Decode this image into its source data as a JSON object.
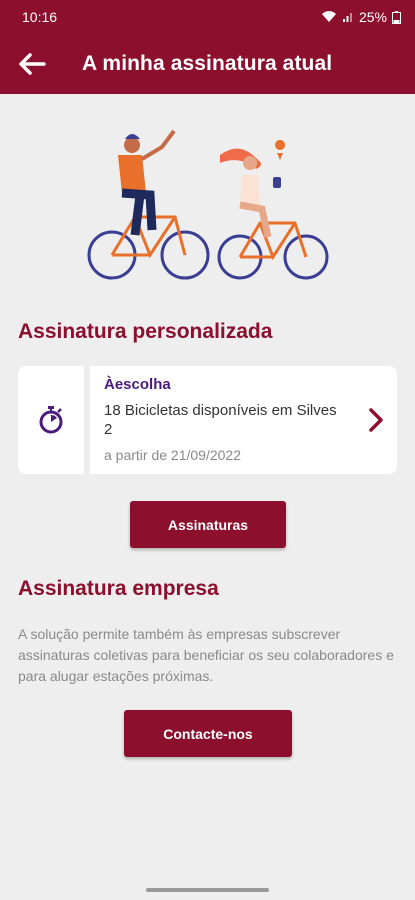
{
  "status_bar": {
    "time": "10:16",
    "battery": "25%"
  },
  "app_bar": {
    "title": "A minha assinatura atual"
  },
  "sections": {
    "personal_title": "Assinatura personalizada",
    "business_title": "Assinatura empresa"
  },
  "subscription_card": {
    "name": "Àescolha",
    "description": "18 Bicicletas disponíveis em Silves 2",
    "date": "a partir de 21/09/2022"
  },
  "buttons": {
    "subscriptions": "Assinaturas",
    "contact": "Contacte-nos"
  },
  "business_description": "A solução permite também às empresas subscrever assinaturas coletivas para beneficiar os seu colaboradores e para alugar estações próximas.",
  "colors": {
    "primary": "#8c0f2e",
    "accent_purple": "#4b1b7a",
    "background": "#eeeeee"
  }
}
